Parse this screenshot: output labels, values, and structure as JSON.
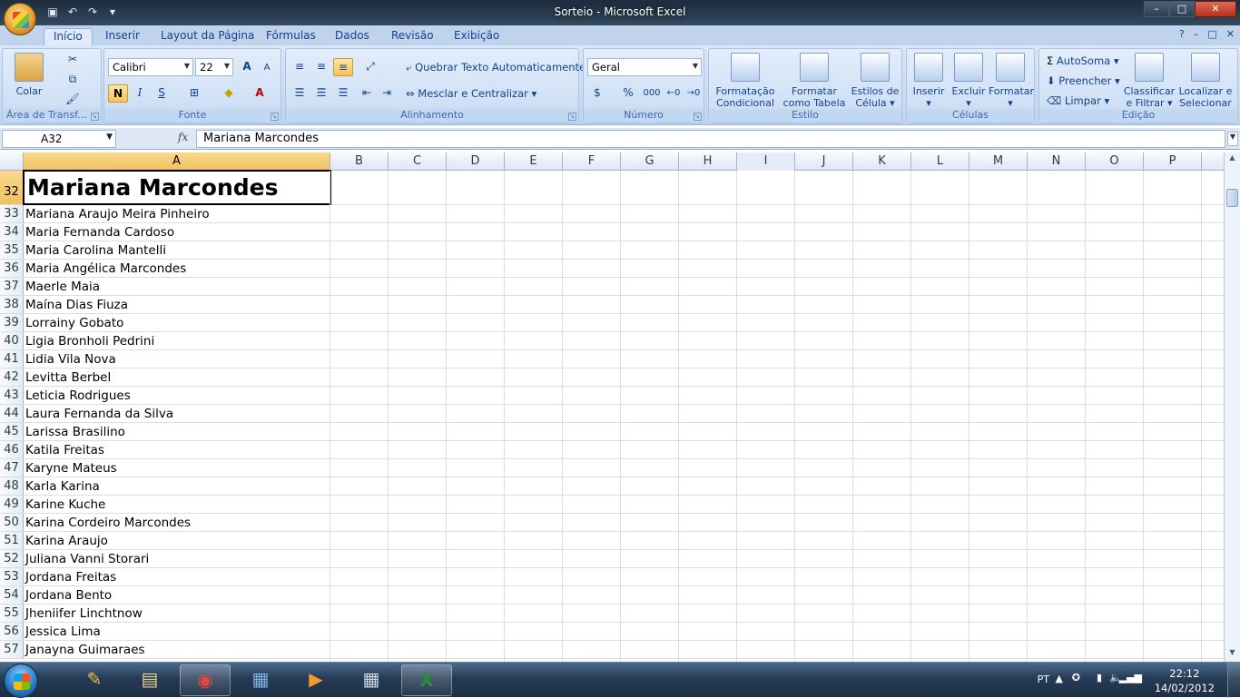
{
  "window": {
    "title": "Sorteio - Microsoft Excel",
    "controls": {
      "minimize": "–",
      "maximize": "□",
      "close": "✕"
    }
  },
  "qat": {
    "save_icon": "save-icon",
    "undo_icon": "undo-icon",
    "redo_icon": "redo-icon"
  },
  "tabs": [
    "Início",
    "Inserir",
    "Layout da Página",
    "Fórmulas",
    "Dados",
    "Revisão",
    "Exibição"
  ],
  "active_tab": "Início",
  "ribbon": {
    "clipboard": {
      "label": "Área de Transf...",
      "paste": "Colar"
    },
    "font": {
      "label": "Fonte",
      "name": "Calibri",
      "size": "22",
      "bold": "N",
      "italic": "I",
      "underline": "S",
      "grow": "A",
      "shrink": "A"
    },
    "alignment": {
      "label": "Alinhamento",
      "wrap": "Quebrar Texto Automaticamente",
      "merge": "Mesclar e Centralizar"
    },
    "number": {
      "label": "Número",
      "format": "Geral",
      "percent": "%",
      "thousands": "000"
    },
    "styles": {
      "label": "Estilo",
      "cond1": "Formatação",
      "cond2": "Condicional",
      "table1": "Formatar",
      "table2": "como Tabela",
      "cell1": "Estilos de",
      "cell2": "Célula"
    },
    "cells": {
      "label": "Células",
      "insert": "Inserir",
      "delete": "Excluir",
      "format": "Formatar"
    },
    "editing": {
      "label": "Edição",
      "autosum": "AutoSoma",
      "fill": "Preencher",
      "clear": "Limpar",
      "sort1": "Classificar",
      "sort2": "e Filtrar",
      "find1": "Localizar e",
      "find2": "Selecionar"
    }
  },
  "formula_bar": {
    "name_box": "A32",
    "fx": "fx",
    "content": "Mariana Marcondes"
  },
  "columns": [
    "A",
    "B",
    "C",
    "D",
    "E",
    "F",
    "G",
    "H",
    "I",
    "J",
    "K",
    "L",
    "M",
    "N",
    "O",
    "P"
  ],
  "selected_column": "A",
  "rows": [
    {
      "n": "32",
      "a": "Mariana Marcondes"
    },
    {
      "n": "33",
      "a": "Mariana Araujo Meira Pinheiro"
    },
    {
      "n": "34",
      "a": "Maria Fernanda Cardoso"
    },
    {
      "n": "35",
      "a": "Maria Carolina Mantelli"
    },
    {
      "n": "36",
      "a": "Maria Angélica Marcondes"
    },
    {
      "n": "37",
      "a": "Maerle Maia"
    },
    {
      "n": "38",
      "a": "Maína Dias Fiuza"
    },
    {
      "n": "39",
      "a": "Lorrainy Gobato"
    },
    {
      "n": "40",
      "a": "Ligia Bronholi Pedrini"
    },
    {
      "n": "41",
      "a": "Lidia Vila Nova"
    },
    {
      "n": "42",
      "a": "Levitta Berbel"
    },
    {
      "n": "43",
      "a": "Leticia Rodrigues"
    },
    {
      "n": "44",
      "a": "Laura Fernanda da Silva"
    },
    {
      "n": "45",
      "a": "Larissa Brasilino"
    },
    {
      "n": "46",
      "a": "Katila Freitas"
    },
    {
      "n": "47",
      "a": "Karyne Mateus"
    },
    {
      "n": "48",
      "a": "Karla Karina"
    },
    {
      "n": "49",
      "a": "Karine Kuche"
    },
    {
      "n": "50",
      "a": "Karina Cordeiro Marcondes"
    },
    {
      "n": "51",
      "a": "Karina Araujo"
    },
    {
      "n": "52",
      "a": "Juliana Vanni Storari"
    },
    {
      "n": "53",
      "a": "Jordana Freitas"
    },
    {
      "n": "54",
      "a": "Jordana Bento"
    },
    {
      "n": "55",
      "a": "Jheniifer Linchtnow"
    },
    {
      "n": "56",
      "a": "Jessica Lima"
    },
    {
      "n": "57",
      "a": "Janayna Guimaraes"
    }
  ],
  "taskbar": {
    "apps": [
      "paint-icon",
      "explorer-icon",
      "chrome-icon",
      "photo-viewer-icon",
      "media-player-icon",
      "calculator-icon",
      "excel-icon"
    ],
    "language": "PT",
    "time": "22:12",
    "date": "14/02/2012"
  }
}
